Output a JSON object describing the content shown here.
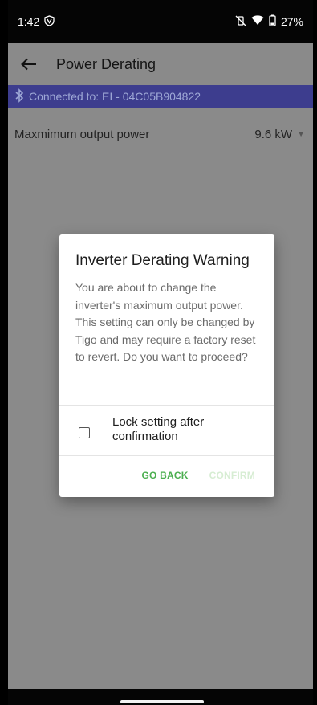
{
  "status": {
    "time": "1:42",
    "left_icon": "shield-v-icon",
    "battery": "27%"
  },
  "appbar": {
    "title": "Power Derating"
  },
  "connection": {
    "text": "Connected to: EI - 04C05B904822"
  },
  "setting": {
    "label": "Maxmimum output power",
    "value": "9.6 kW"
  },
  "dialog": {
    "title": "Inverter Derating Warning",
    "body": "You are about to change the inverter's maximum output power. This setting can only be changed by Tigo and may require a factory reset to revert. Do you want to proceed?",
    "checkbox_label": "Lock setting after confirmation",
    "checkbox_checked": false,
    "go_back": "GO BACK",
    "confirm": "CONFIRM"
  },
  "colors": {
    "banner": "#3d3d8e",
    "accent": "#4caf50",
    "confirm_disabled": "#d7edd3",
    "scrim": "#8a8a8a"
  }
}
